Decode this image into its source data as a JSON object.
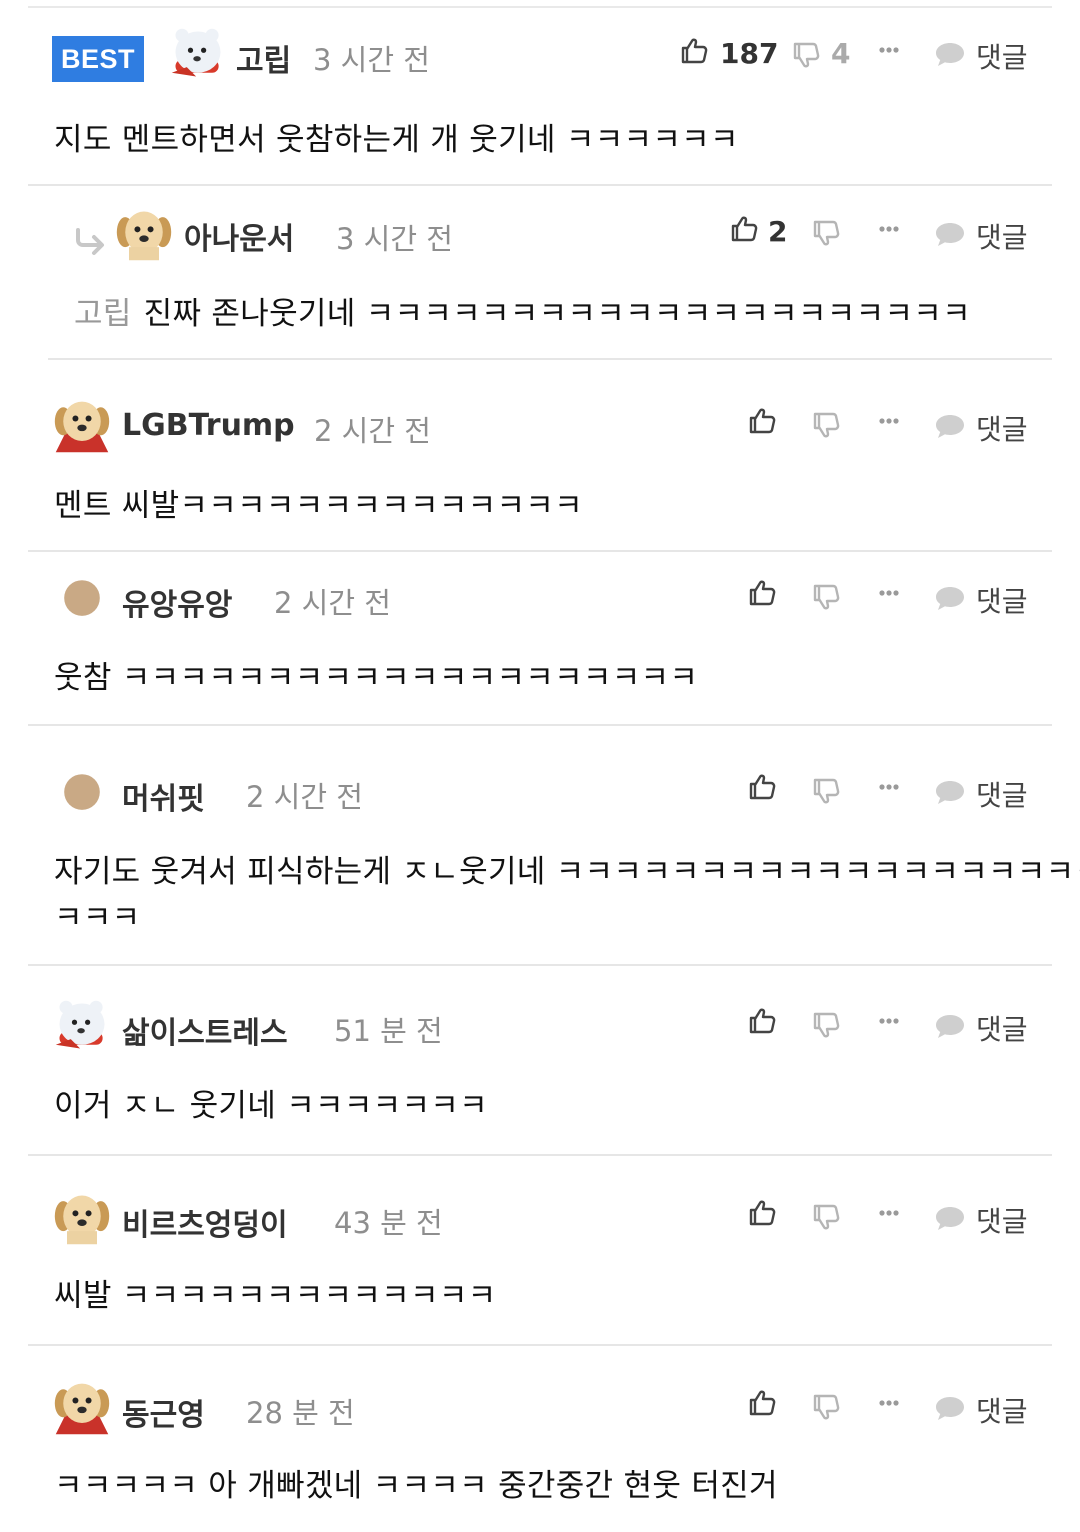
{
  "comments": [
    {
      "badge": "BEST",
      "avatar": "polar-bear",
      "nick": "고립",
      "time": "3 시간 전",
      "likes": "187",
      "dislikes": "4",
      "reply": "댓글",
      "text": "지도 멘트하면서 웃참하는게 개 웃기네 ㅋㅋㅋㅋㅋㅋ"
    },
    {
      "avatar": "puppy",
      "nick": "아나운서",
      "time": "3 시간 전",
      "likes": "2",
      "reply": "댓글",
      "mention": "고립",
      "text": "진짜 존나웃기네 ㅋㅋㅋㅋㅋㅋㅋㅋㅋㅋㅋㅋㅋㅋㅋㅋㅋㅋㅋㅋㅋ"
    },
    {
      "avatar": "puppy-cape",
      "nick": "LGBTrump",
      "time": "2 시간 전",
      "reply": "댓글",
      "text": "멘트 씨발ㅋㅋㅋㅋㅋㅋㅋㅋㅋㅋㅋㅋㅋㅋ"
    },
    {
      "avatar": "plain-circle",
      "nick": "유앙유앙",
      "time": "2 시간 전",
      "reply": "댓글",
      "text": "웃참 ㅋㅋㅋㅋㅋㅋㅋㅋㅋㅋㅋㅋㅋㅋㅋㅋㅋㅋㅋㅋ"
    },
    {
      "avatar": "plain-circle",
      "nick": "머쉬핏",
      "time": "2 시간 전",
      "reply": "댓글",
      "text": "자기도 웃겨서 피식하는게 ㅈㄴ웃기네 ㅋㅋㅋㅋㅋㅋㅋㅋㅋㅋㅋㅋㅋㅋㅋㅋㅋㅋㅋ",
      "text2": "ㅋㅋㅋ"
    },
    {
      "avatar": "polar-bear",
      "nick": "삶이스트레스",
      "time": "51 분 전",
      "reply": "댓글",
      "text": "이거 ㅈㄴ 웃기네 ㅋㅋㅋㅋㅋㅋㅋ"
    },
    {
      "avatar": "puppy",
      "nick": "비르츠엉덩이",
      "time": "43 분 전",
      "reply": "댓글",
      "text": "씨발 ㅋㅋㅋㅋㅋㅋㅋㅋㅋㅋㅋㅋㅋ"
    },
    {
      "avatar": "puppy-cape",
      "nick": "동근영",
      "time": "28 분 전",
      "reply": "댓글",
      "text": "ㅋㅋㅋㅋㅋ 아 개빠겠네 ㅋㅋㅋㅋ 중간중간 현웃 터진거"
    }
  ]
}
